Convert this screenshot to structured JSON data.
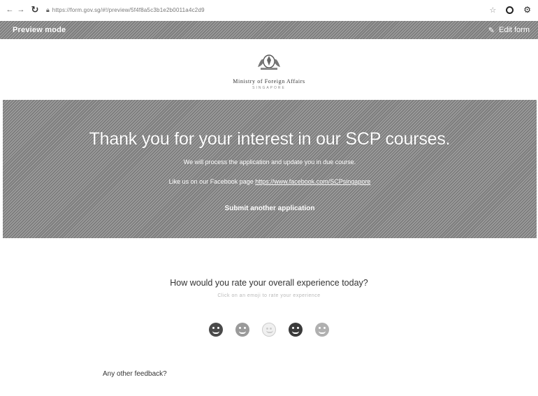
{
  "browser": {
    "back_icon": "back-arrow-icon",
    "forward_icon": "forward-arrow-icon",
    "reload_icon": "reload-icon",
    "url": "https://form.gov.sg/#!/preview/5f4f8a5c3b1e2b0011a4c2d9"
  },
  "preview_bar": {
    "label": "Preview mode",
    "edit_label": "Edit form"
  },
  "logo": {
    "name": "Ministry of Foreign Affairs",
    "sub": "SINGAPORE"
  },
  "banner": {
    "title": "Thank you for your interest in our SCP courses.",
    "line1": "We will process the application and update you in due course.",
    "line2_prefix": "Like us on our Facebook page ",
    "link": "https://www.facebook.com/SCPsingapore",
    "submit_another": "Submit another application"
  },
  "rating": {
    "question": "How would you rate your overall experience today?",
    "subtitle": "Click on an emoji to rate your experience"
  },
  "feedback": {
    "label": "Any other feedback?"
  },
  "colors": {
    "banner": "#8e8e8e",
    "preview_bar": "#8e8e8e"
  }
}
